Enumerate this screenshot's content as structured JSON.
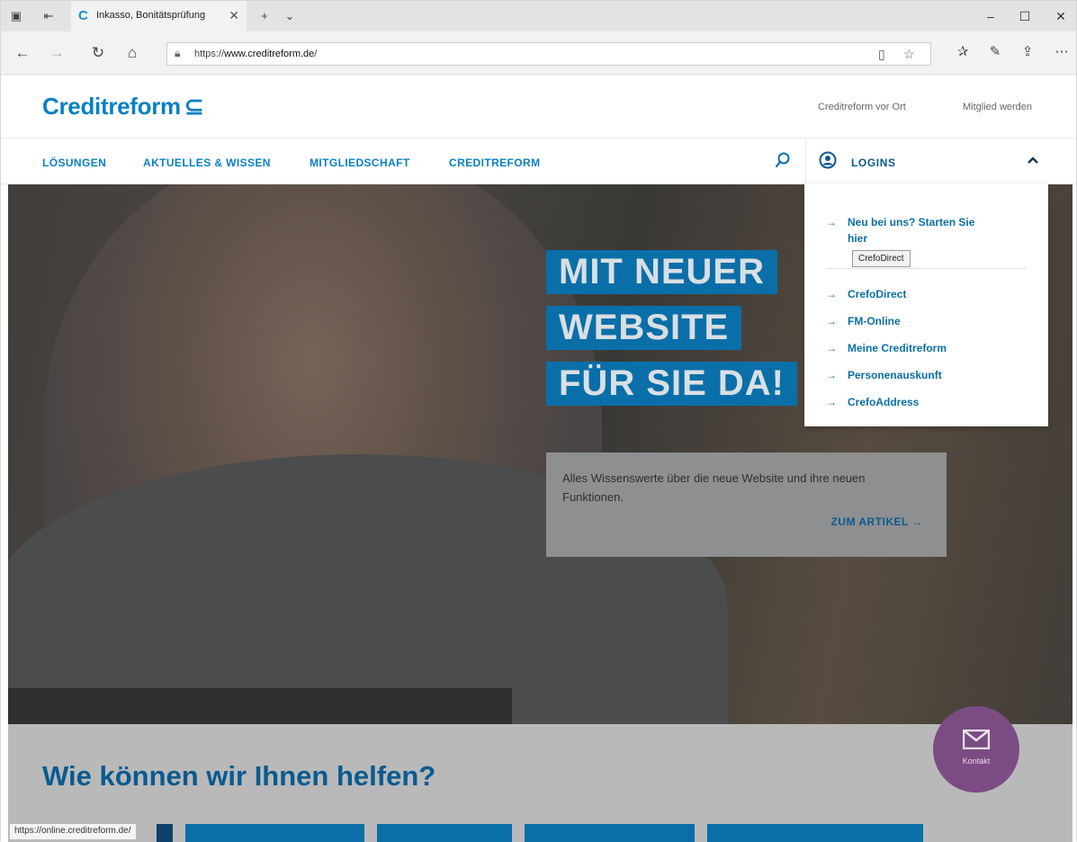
{
  "browser": {
    "tab_title": "Inkasso, Bonitätsprüfung",
    "url_prefix": "https://",
    "url_domain": "www.creditreform.de",
    "url_suffix": "/"
  },
  "site": {
    "logo_text": "Creditreform",
    "util_links": [
      "Creditreform vor Ort",
      "Mitglied werden"
    ],
    "nav": [
      "LÖSUNGEN",
      "AKTUELLES & WISSEN",
      "MITGLIEDSCHAFT",
      "CREDITREFORM"
    ],
    "logins_label": "LOGINS"
  },
  "hero": {
    "headline": [
      "MIT NEUER",
      "WEBSITE",
      "FÜR SIE DA!"
    ],
    "teaser_text": "Alles Wissenswerte über die neue Website und ihre neuen Funktionen.",
    "teaser_link": "ZUM ARTIKEL"
  },
  "logins_menu": {
    "first_line1": "Neu bei uns? Starten Sie",
    "first_line2": "hier",
    "items": [
      "CrefoDirect",
      "FM-Online",
      "Meine Creditreform",
      "Personenauskunft",
      "CrefoAddress"
    ],
    "tooltip": "CrefoDirect"
  },
  "lower": {
    "title": "Wie können wir Ihnen helfen?"
  },
  "contact": {
    "label": "Kontakt"
  },
  "statusbar": {
    "url": "https://online.creditreform.de/"
  },
  "colors": {
    "brand_blue": "#0a80c2",
    "contact_purple": "#7b4c83"
  }
}
